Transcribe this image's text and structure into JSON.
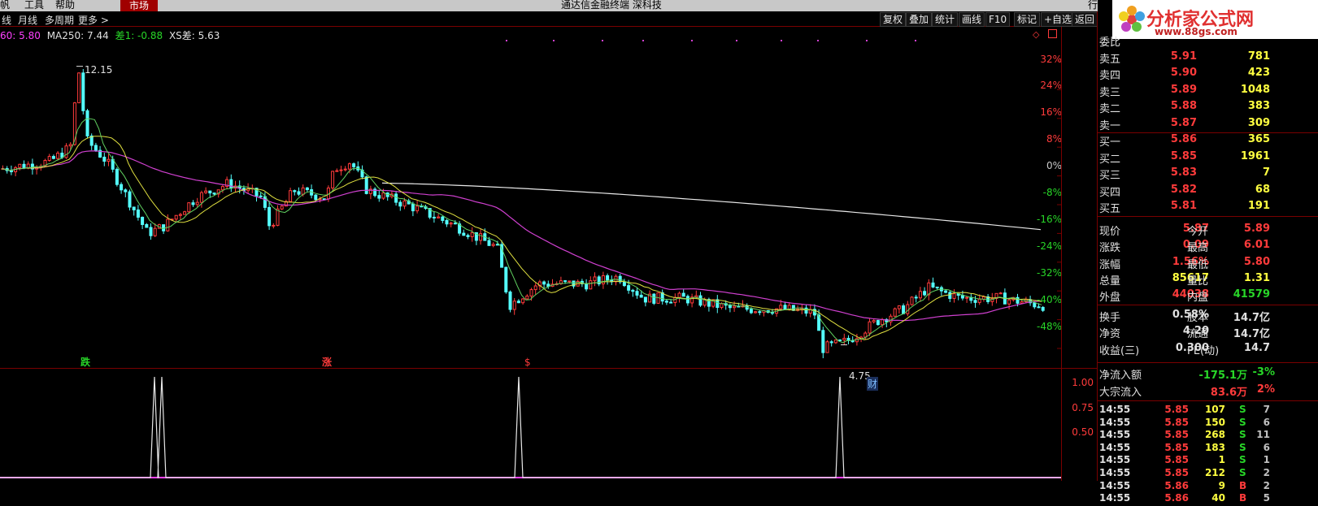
{
  "menubar": {
    "items": [
      "帆",
      "工具",
      "帮助"
    ],
    "market_label": "市场",
    "title": "通达信金融终端 深科技",
    "right_fragment": "行"
  },
  "toolbar": {
    "left": [
      "线",
      "月线",
      "多周期",
      "更多 >"
    ],
    "buttons": [
      "复权",
      "叠加",
      "统计",
      "画线",
      "F10",
      "标记",
      "+自选",
      "返回"
    ]
  },
  "indicator_line": [
    {
      "text": "60: 5.80",
      "color": "#ff40ff"
    },
    {
      "text": "MA250: 7.44",
      "color": "#e0e0e0"
    },
    {
      "text": "差1: -0.88",
      "color": "#28d628"
    },
    {
      "text": "XS差: 5.63",
      "color": "#e0e0e0"
    }
  ],
  "price_axis": [
    "32%",
    "24%",
    "16%",
    "8%",
    "0%",
    "-8%",
    "-16%",
    "-24%",
    "-32%",
    "-40%",
    "-48%"
  ],
  "sub_axis": [
    "1.00",
    "0.75",
    "0.50"
  ],
  "annotations": {
    "high": "12.15",
    "low": "4.75",
    "die": "跌",
    "zhang": "涨",
    "dollar": "$",
    "cai": "财"
  },
  "logo": {
    "text": "分析家公式网",
    "url": "www.88gs.com"
  },
  "order_book": [
    {
      "label": "委比",
      "price": "",
      "vol": ""
    },
    {
      "label": "卖五",
      "price": "5.91",
      "vol": "781"
    },
    {
      "label": "卖四",
      "price": "5.90",
      "vol": "423"
    },
    {
      "label": "卖三",
      "price": "5.89",
      "vol": "1048"
    },
    {
      "label": "卖二",
      "price": "5.88",
      "vol": "383"
    },
    {
      "label": "卖一",
      "price": "5.87",
      "vol": "309"
    },
    {
      "label": "买一",
      "price": "5.86",
      "vol": "365"
    },
    {
      "label": "买二",
      "price": "5.85",
      "vol": "1961"
    },
    {
      "label": "买三",
      "price": "5.83",
      "vol": "7"
    },
    {
      "label": "买四",
      "price": "5.82",
      "vol": "68"
    },
    {
      "label": "买五",
      "price": "5.81",
      "vol": "191"
    }
  ],
  "quote": [
    {
      "l1": "现价",
      "v1": "5.87",
      "l2": "今开",
      "v2": "5.89"
    },
    {
      "l1": "涨跌",
      "v1": "0.09",
      "l2": "最高",
      "v2": "6.01"
    },
    {
      "l1": "涨幅",
      "v1": "1.56%",
      "l2": "最低",
      "v2": "5.80"
    },
    {
      "l1": "总量",
      "v1": "85617",
      "l2": "量比",
      "v2": "1.31"
    },
    {
      "l1": "外盘",
      "v1": "44038",
      "l2": "内盘",
      "v2": "41579"
    }
  ],
  "stats": [
    {
      "l1": "换手",
      "v1": "0.58%",
      "l2": "股本",
      "v2": "14.7亿"
    },
    {
      "l1": "净资",
      "v1": "4.20",
      "l2": "流通",
      "v2": "14.7亿"
    },
    {
      "l1": "收益(三)",
      "v1": "0.300",
      "l2": "PE(动)",
      "v2": "14.7"
    }
  ],
  "flows": [
    {
      "label": "净流入额",
      "value": "-175.1万",
      "pct": "-3%"
    },
    {
      "label": "大宗流入",
      "value": "83.6万",
      "pct": "2%"
    }
  ],
  "trades": [
    {
      "time": "14:55",
      "price": "5.85",
      "vol": "107",
      "side": "S",
      "n": "7"
    },
    {
      "time": "14:55",
      "price": "5.85",
      "vol": "150",
      "side": "S",
      "n": "6"
    },
    {
      "time": "14:55",
      "price": "5.85",
      "vol": "268",
      "side": "S",
      "n": "11"
    },
    {
      "time": "14:55",
      "price": "5.85",
      "vol": "183",
      "side": "S",
      "n": "6"
    },
    {
      "time": "14:55",
      "price": "5.85",
      "vol": "1",
      "side": "S",
      "n": "1"
    },
    {
      "time": "14:55",
      "price": "5.85",
      "vol": "212",
      "side": "S",
      "n": "2"
    },
    {
      "time": "14:55",
      "price": "5.86",
      "vol": "9",
      "side": "B",
      "n": "2"
    },
    {
      "time": "14:55",
      "price": "5.86",
      "vol": "40",
      "side": "B",
      "n": "5"
    }
  ]
}
